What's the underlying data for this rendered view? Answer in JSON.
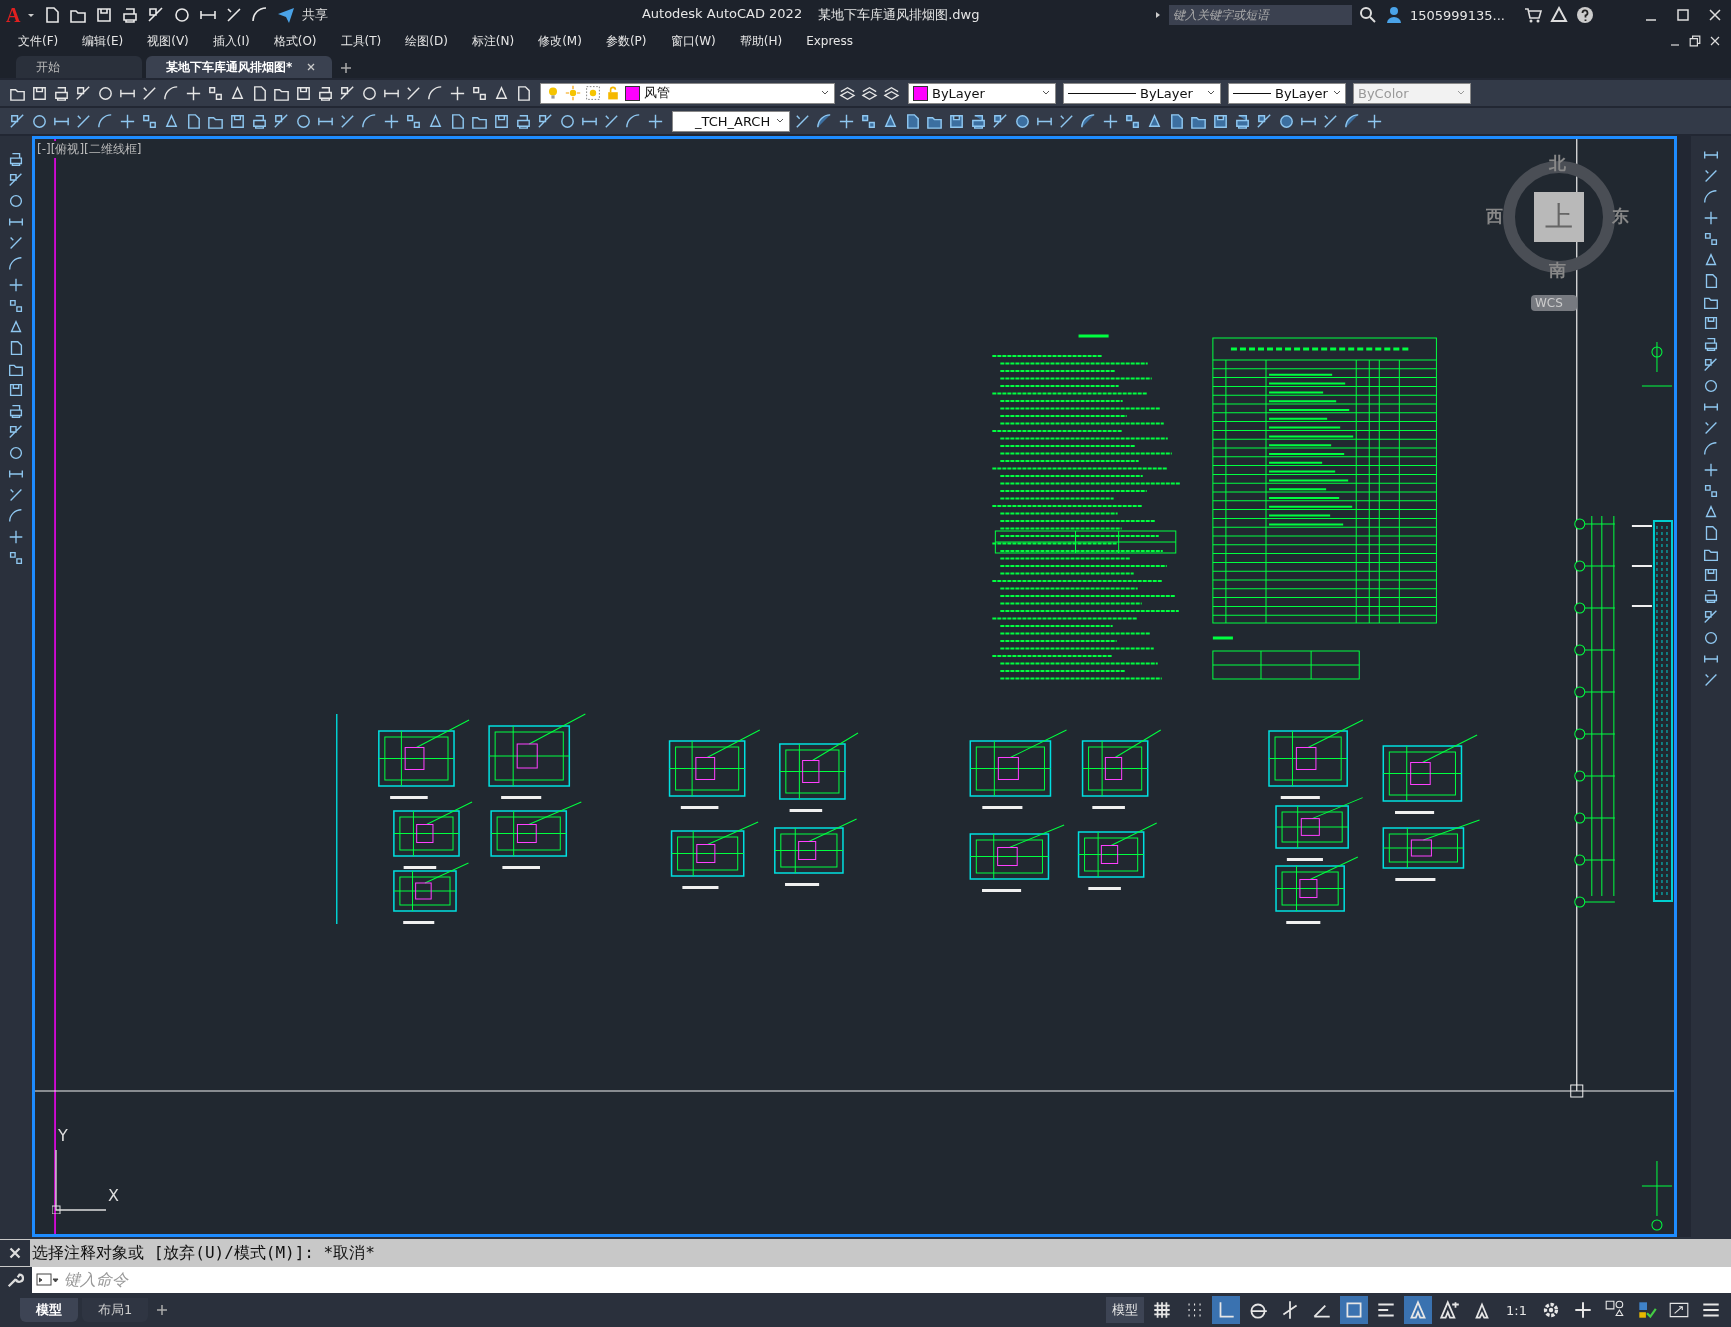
{
  "app": {
    "logo": "A",
    "share": "共享",
    "name": "Autodesk AutoCAD 2022",
    "file": "某地下车库通风排烟图.dwg"
  },
  "search": {
    "placeholder": "键入关键字或短语"
  },
  "user": {
    "name": "1505999135..."
  },
  "menus": [
    "文件(F)",
    "编辑(E)",
    "视图(V)",
    "插入(I)",
    "格式(O)",
    "工具(T)",
    "绘图(D)",
    "标注(N)",
    "修改(M)",
    "参数(P)",
    "窗口(W)",
    "帮助(H)",
    "Express"
  ],
  "tabs": [
    {
      "label": "开始",
      "selected": false
    },
    {
      "label": "某地下车库通风排烟图*",
      "selected": true
    }
  ],
  "properties": {
    "layer": "风管",
    "color_name": "ByLayer",
    "linetype": "ByLayer",
    "lineweight": "ByLayer",
    "plotstyle": "ByColor",
    "plotstyle_disabled": true
  },
  "text_style": "_TCH_ARCH",
  "viewport_label": "[-][俯视][二维线框]",
  "viewcube": {
    "north": "北",
    "south": "南",
    "east": "东",
    "west": "西",
    "face": "上",
    "ucs": "WCS"
  },
  "ucs_icon": {
    "x": "X",
    "y": "Y"
  },
  "command": {
    "history": "选择注释对象或 [放弃(U)/模式(M)]: *取消*",
    "placeholder": "键入命令"
  },
  "layout_tabs": [
    {
      "label": "模型",
      "selected": true
    },
    {
      "label": "布局1",
      "selected": false
    }
  ],
  "status_bar": {
    "model": "模型",
    "scale": "1:1",
    "toggles": [
      {
        "kind": "grid",
        "on": false
      },
      {
        "kind": "snap",
        "on": false
      },
      {
        "kind": "ortho",
        "on": true
      },
      {
        "kind": "polar",
        "on": false
      },
      {
        "kind": "otrack",
        "on": false
      },
      {
        "kind": "angle",
        "on": false
      },
      {
        "kind": "selection",
        "on": true
      },
      {
        "kind": "lineweight",
        "on": false
      },
      {
        "kind": "annovis",
        "on": true
      },
      {
        "kind": "autoscale",
        "on": false
      },
      {
        "kind": "annoscale",
        "on": false
      }
    ]
  }
}
